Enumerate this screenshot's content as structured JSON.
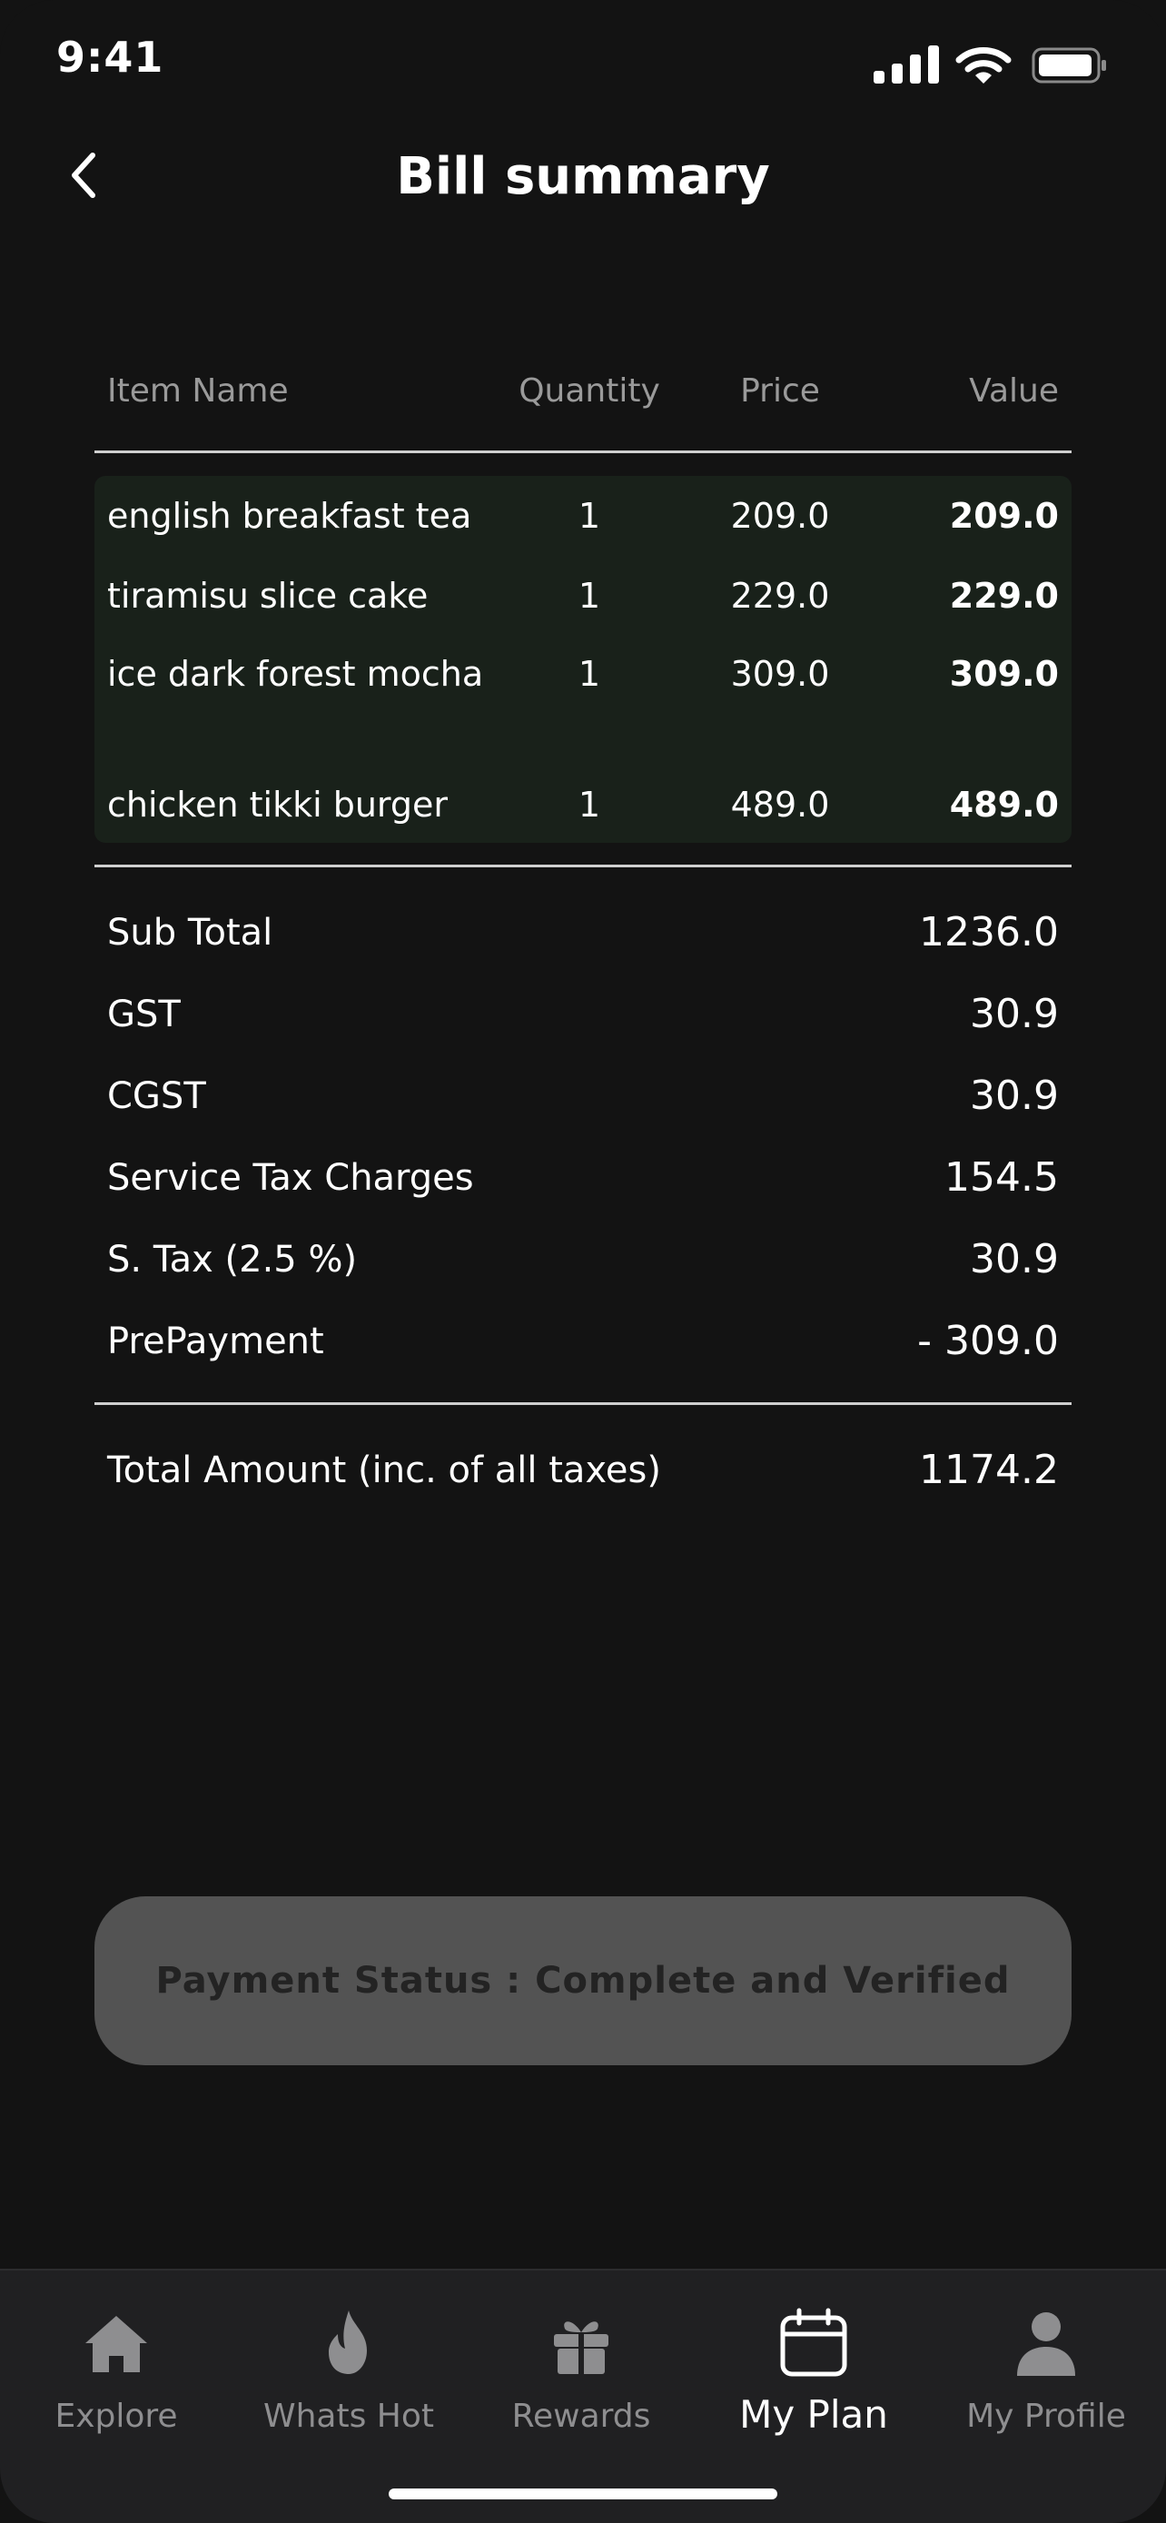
{
  "status_bar": {
    "time": "9:41"
  },
  "header": {
    "title": "Bill summary"
  },
  "table": {
    "headers": {
      "name": "Item Name",
      "qty": "Quantity",
      "price": "Price",
      "value": "Value"
    },
    "items": [
      {
        "name": "english breakfast tea",
        "qty": "1",
        "price": "209.0",
        "value": "209.0"
      },
      {
        "name": "tiramisu slice cake",
        "qty": "1",
        "price": "229.0",
        "value": "229.0"
      },
      {
        "name": "ice dark forest mocha",
        "qty": "1",
        "price": "309.0",
        "value": "309.0"
      },
      {
        "name": "chicken tikki burger",
        "qty": "1",
        "price": "489.0",
        "value": "489.0"
      }
    ]
  },
  "summary": [
    {
      "label": "Sub Total",
      "amount": "1236.0"
    },
    {
      "label": "GST",
      "amount": "30.9"
    },
    {
      "label": "CGST",
      "amount": "30.9"
    },
    {
      "label": "Service Tax Charges",
      "amount": "154.5"
    },
    {
      "label": "S. Tax  (2.5 %)",
      "amount": "30.9"
    },
    {
      "label": "PrePayment",
      "amount": "- 309.0"
    }
  ],
  "total": {
    "label": "Total Amount (inc. of all taxes)",
    "amount": "1174.2"
  },
  "payment_status": "Payment Status : Complete and Verified",
  "tabs": [
    {
      "label": "Explore",
      "icon": "home-icon"
    },
    {
      "label": "Whats Hot",
      "icon": "flame-icon"
    },
    {
      "label": "Rewards",
      "icon": "gift-icon"
    },
    {
      "label": "My Plan",
      "icon": "calendar-icon",
      "active": true
    },
    {
      "label": "My Profile",
      "icon": "person-icon"
    }
  ],
  "colors": {
    "background": "#131313",
    "items_bg": "#19211a",
    "status_button": "#535353",
    "tab_bar": "#202022"
  }
}
